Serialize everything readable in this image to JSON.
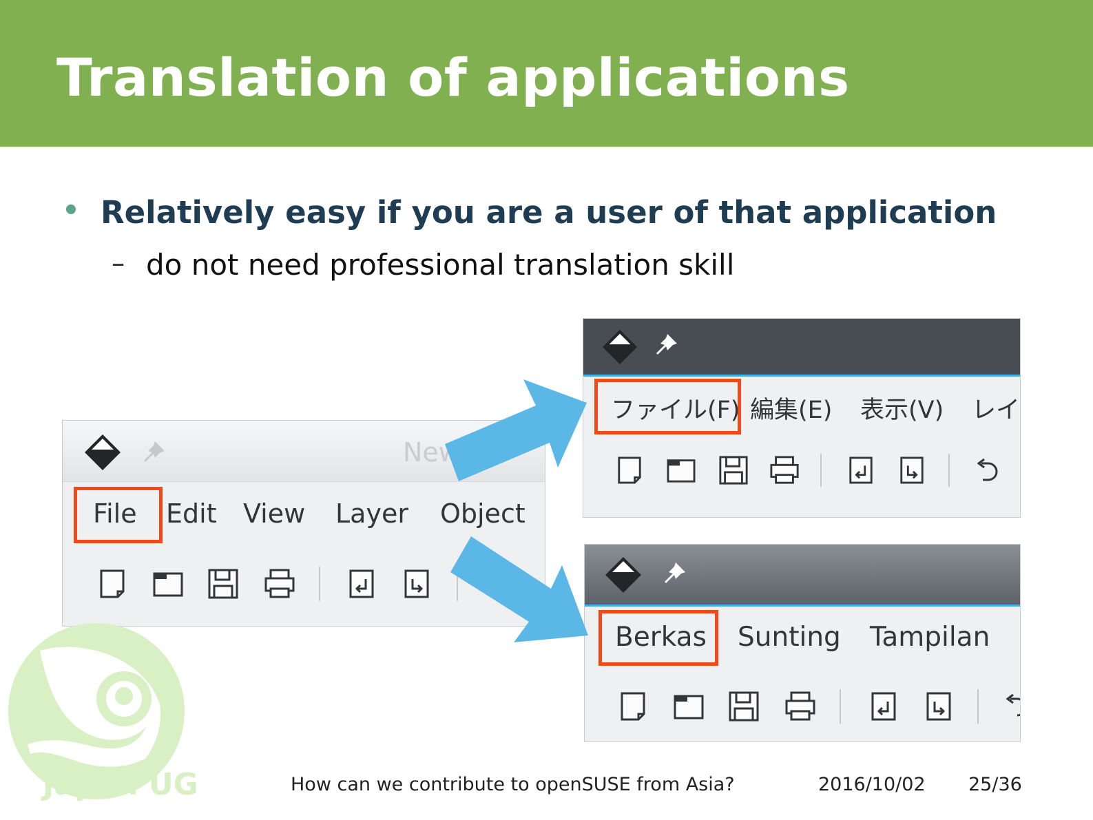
{
  "slide": {
    "title": "Translation of applications",
    "bullet1": "Relatively easy if you are a user of that application",
    "bullet2_dash": "–",
    "bullet2": "do not need professional translation skill"
  },
  "window_en": {
    "title_partial": "New",
    "menu": [
      "File",
      "Edit",
      "View",
      "Layer",
      "Object"
    ]
  },
  "window_ja": {
    "menu": [
      "ファイル(F)",
      "編集(E)",
      "表示(V)",
      "レイ"
    ]
  },
  "window_id": {
    "menu": [
      "Berkas",
      "Sunting",
      "Tampilan"
    ]
  },
  "logo": {
    "text": "Japan UG"
  },
  "footer": {
    "talk": "How can we contribute to openSUSE from Asia?",
    "date": "2016/10/02",
    "page": "25/36"
  },
  "colors": {
    "header": "#80b050",
    "highlight": "#f04a1a",
    "arrow": "#5bb8e6",
    "accent": "#3daee9"
  }
}
